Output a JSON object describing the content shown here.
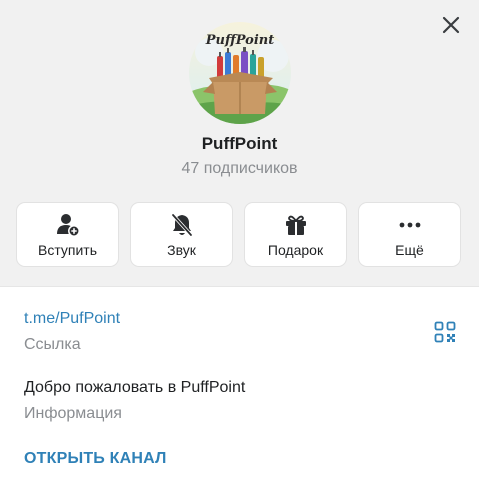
{
  "channel": {
    "name": "PuffPoint",
    "subscribers": "47 подписчиков",
    "avatar_logo_text": "PuffPoint"
  },
  "actions": [
    {
      "label": "Вступить",
      "icon": "add-user-icon"
    },
    {
      "label": "Звук",
      "icon": "bell-off-icon"
    },
    {
      "label": "Подарок",
      "icon": "gift-icon"
    },
    {
      "label": "Ещё",
      "icon": "more-dots-icon"
    }
  ],
  "info": {
    "link": "t.me/PufPoint",
    "link_caption": "Ссылка",
    "description": "Добро пожаловать в PuffPoint",
    "description_caption": "Информация"
  },
  "open_channel_label": "ОТКРЫТЬ КАНАЛ",
  "colors": {
    "accent": "#2f81b7",
    "header_bg": "#f1f1f1",
    "text_primary": "#1f2123",
    "text_secondary": "#8a8d91"
  }
}
